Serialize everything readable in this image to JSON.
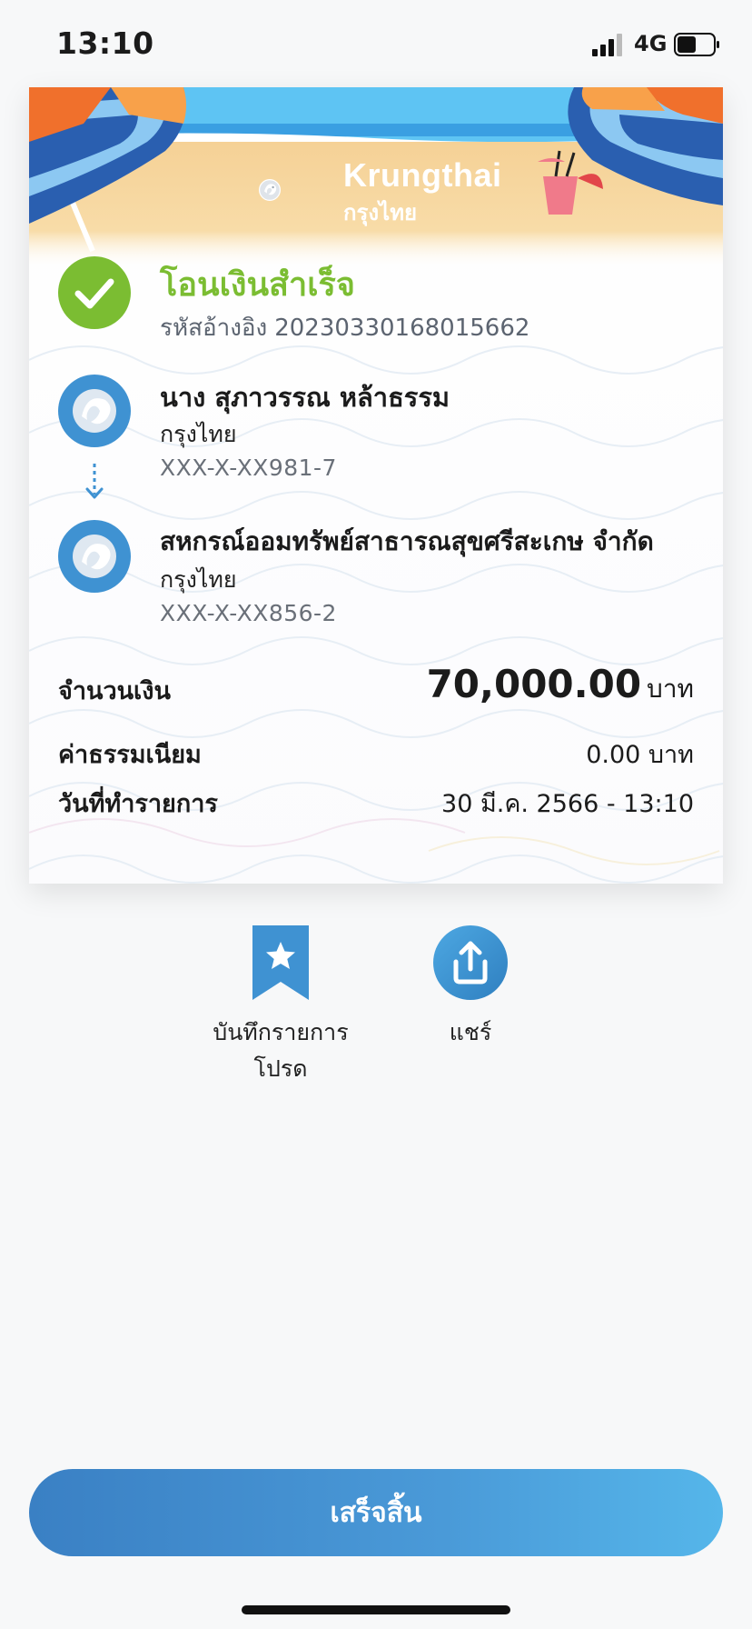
{
  "status_bar": {
    "time": "13:10",
    "network": "4G"
  },
  "receipt": {
    "brand_en": "Krungthai",
    "brand_th": "กรุงไทย",
    "status_title": "โอนเงินสำเร็จ",
    "reference_label": "รหัสอ้างอิง",
    "reference_number": "20230330168015662",
    "sender": {
      "name": "นาง สุภาวรรณ หล้าธรรม",
      "bank": "กรุงไทย",
      "account": "XXX-X-XX981-7"
    },
    "recipient": {
      "name": "สหกรณ์ออมทรัพย์สาธารณสุขศรีสะเกษ จำกัด",
      "bank": "กรุงไทย",
      "account": "XXX-X-XX856-2"
    },
    "amount_label": "จำนวนเงิน",
    "amount_value": "70,000.00",
    "amount_unit": "บาท",
    "fee_label": "ค่าธรรมเนียม",
    "fee_value": "0.00 บาท",
    "date_label": "วันที่ทำรายการ",
    "date_value": "30 มี.ค. 2566 - 13:10"
  },
  "actions": {
    "save_favorite_line1": "บันทึกรายการ",
    "save_favorite_line2": "โปรด",
    "share_label": "แชร์"
  },
  "done_label": "เสร็จสิ้น",
  "colors": {
    "success_green": "#7bbd32",
    "brand_blue": "#3a80c4",
    "accent_light_blue": "#55b6ea"
  }
}
